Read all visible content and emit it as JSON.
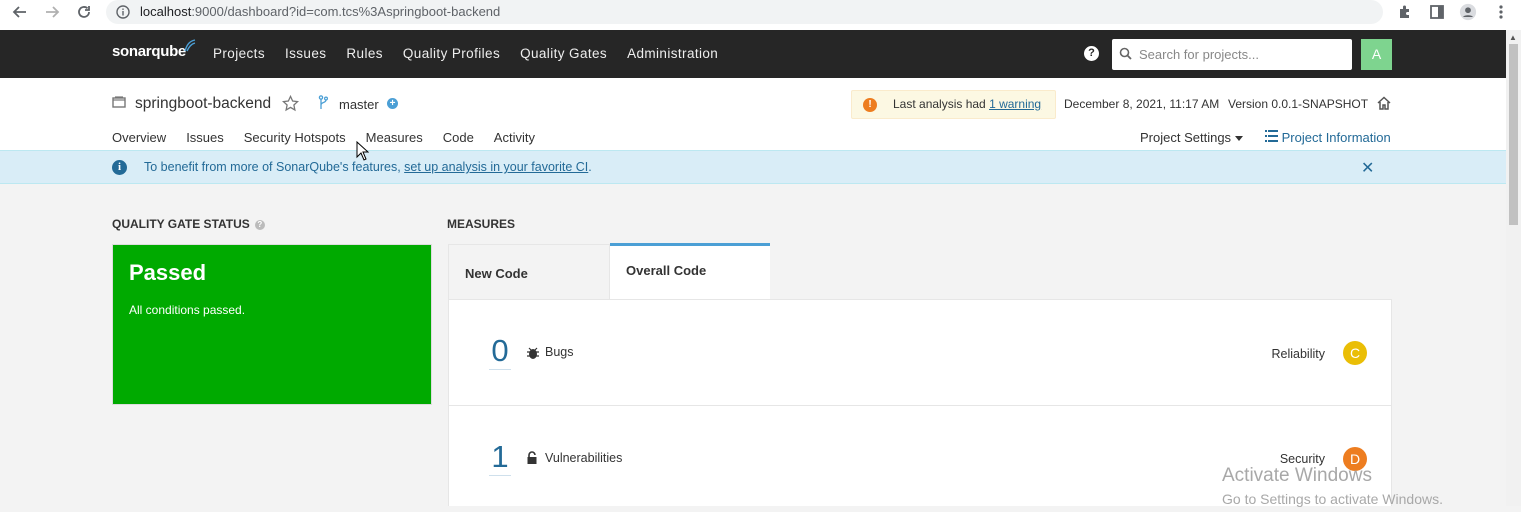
{
  "browser": {
    "url_host": "localhost",
    "url_rest": ":9000/dashboard?id=com.tcs%3Aspringboot-backend"
  },
  "nav": {
    "logo": "sonarqube",
    "links": [
      "Projects",
      "Issues",
      "Rules",
      "Quality Profiles",
      "Quality Gates",
      "Administration"
    ],
    "search_placeholder": "Search for projects...",
    "avatar_letter": "A"
  },
  "project": {
    "name": "springboot-backend",
    "branch": "master",
    "warning_prefix": "Last analysis had ",
    "warning_link": "1 warning",
    "analysis_date": "December 8, 2021, 11:17 AM",
    "version": "Version 0.0.1-SNAPSHOT",
    "tabs": [
      "Overview",
      "Issues",
      "Security Hotspots",
      "Measures",
      "Code",
      "Activity"
    ],
    "settings_label": "Project Settings",
    "info_label": "Project Information"
  },
  "banner": {
    "text_before": "To benefit from more of SonarQube's features, ",
    "link": "set up analysis in your favorite CI",
    "text_after": "."
  },
  "quality_gate": {
    "title": "QUALITY GATE STATUS",
    "status": "Passed",
    "message": "All conditions passed.",
    "color": "#00aa00"
  },
  "measures": {
    "title": "MEASURES",
    "tab_new": "New Code",
    "tab_overall": "Overall Code",
    "rows": [
      {
        "value": "0",
        "label": "Bugs",
        "category": "Reliability",
        "rating": "C",
        "rating_color": "#eabe06"
      },
      {
        "value": "1",
        "label": "Vulnerabilities",
        "category": "Security",
        "rating": "D",
        "rating_color": "#ed7d20"
      }
    ]
  },
  "watermark": {
    "line1": "Activate Windows",
    "line2": "Go to Settings to activate Windows."
  }
}
